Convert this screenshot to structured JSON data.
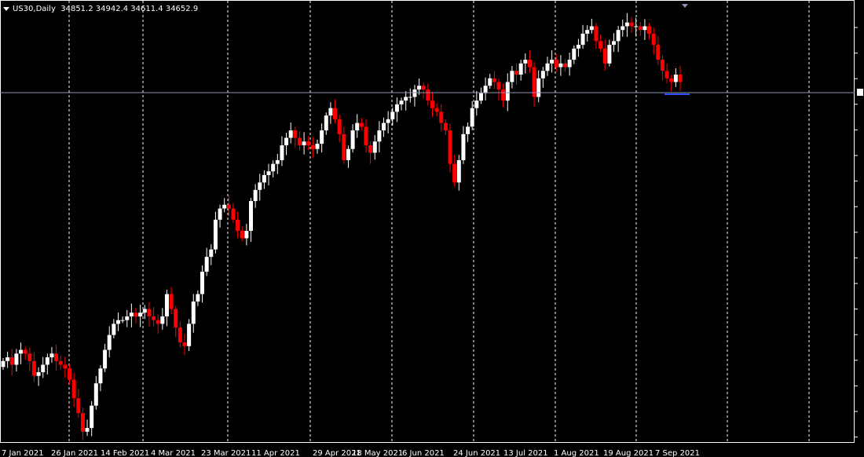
{
  "header": {
    "symbol": "US30,Daily",
    "ohlc": "34851.2 34942.4 34611.4 34652.9"
  },
  "colors": {
    "background": "#000000",
    "bull": "#ffffff",
    "bear": "#ff0000",
    "grid": "#ffffff",
    "price_line": "#8c96b4",
    "bid_marker": "#2a4dff"
  },
  "chart_data": {
    "type": "candlestick",
    "title": "",
    "symbol": "US30",
    "timeframe": "Daily",
    "x_tick_labels": [
      "7 Jan 2021",
      "26 Jan 2021",
      "14 Feb 2021",
      "4 Mar 2021",
      "23 Mar 2021",
      "11 Apr 2021",
      "29 Apr 2021",
      "18 May 2021",
      "6 Jun 2021",
      "24 Jun 2021",
      "13 Jul 2021",
      "1 Aug 2021",
      "19 Aug 2021",
      "7 Sep 2021"
    ],
    "ylim": [
      29800,
      35700
    ],
    "current_price": 34652.9,
    "grid": "vertical-dashed",
    "closes": [
      30900,
      30950,
      30850,
      31000,
      31050,
      31000,
      30900,
      30700,
      30750,
      30850,
      30950,
      31000,
      30900,
      30850,
      30800,
      30650,
      30400,
      30200,
      29950,
      30000,
      30300,
      30600,
      30800,
      31050,
      31250,
      31400,
      31450,
      31450,
      31500,
      31550,
      31500,
      31550,
      31600,
      31500,
      31450,
      31400,
      31500,
      31800,
      31600,
      31350,
      31150,
      31100,
      31400,
      31700,
      31800,
      32100,
      32300,
      32400,
      32800,
      32950,
      33000,
      32950,
      32800,
      32650,
      32550,
      32650,
      33050,
      33200,
      33300,
      33400,
      33450,
      33550,
      33600,
      33800,
      33900,
      34000,
      33900,
      33800,
      33850,
      33800,
      33750,
      33820,
      34000,
      34200,
      34300,
      34150,
      33950,
      33600,
      33750,
      34000,
      34100,
      34050,
      33800,
      33700,
      33850,
      34000,
      34100,
      34150,
      34250,
      34350,
      34400,
      34450,
      34450,
      34550,
      34600,
      34550,
      34400,
      34300,
      34250,
      34100,
      34000,
      33550,
      33300,
      33600,
      33950,
      34050,
      34300,
      34400,
      34500,
      34600,
      34700,
      34650,
      34550,
      34400,
      34650,
      34800,
      34750,
      34900,
      34950,
      34850,
      34450,
      34700,
      34800,
      34900,
      34950,
      34850,
      34900,
      34850,
      34950,
      35100,
      35150,
      35300,
      35350,
      35400,
      35200,
      35100,
      34900,
      35150,
      35200,
      35350,
      35400,
      35450,
      35400,
      35400,
      35350,
      35400,
      35300,
      35150,
      34950,
      34800,
      34700,
      34650,
      34750,
      34650
    ]
  }
}
